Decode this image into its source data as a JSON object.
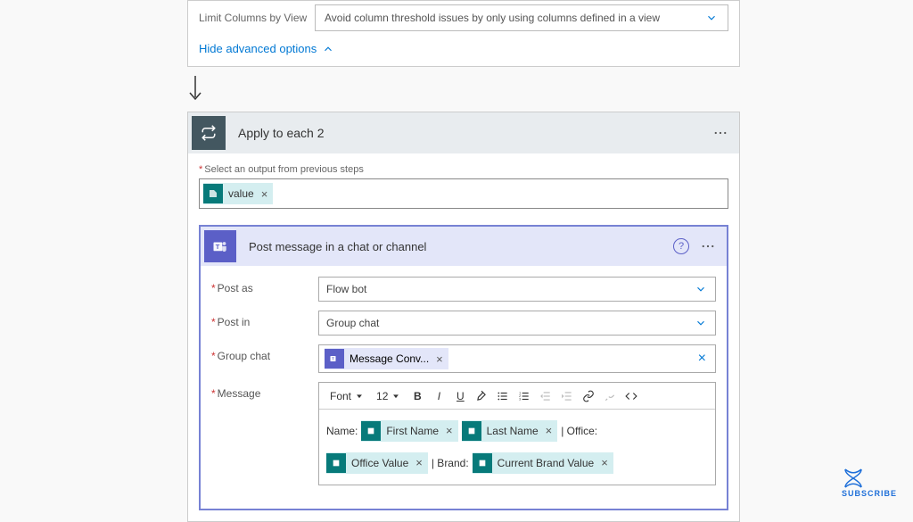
{
  "top": {
    "limit_label": "Limit Columns by View",
    "limit_value": "Avoid column threshold issues by only using columns defined in a view",
    "hide_advanced": "Hide advanced options"
  },
  "loop": {
    "title": "Apply to each 2",
    "select_output_label": "Select an output from previous steps",
    "value_token": "value"
  },
  "teams": {
    "title": "Post message in a chat or channel",
    "post_as_label": "Post as",
    "post_as_value": "Flow bot",
    "post_in_label": "Post in",
    "post_in_value": "Group chat",
    "group_chat_label": "Group chat",
    "group_chat_token": "Message Conv...",
    "message_label": "Message"
  },
  "toolbar": {
    "font_label": "Font",
    "size": "12"
  },
  "message": {
    "name_prefix": "Name:",
    "first_name_token": "First Name",
    "last_name_token": "Last Name",
    "office_prefix": "| Office:",
    "office_value_token": "Office Value",
    "brand_prefix": "| Brand:",
    "brand_value_token": "Current Brand Value"
  },
  "watermark": {
    "text": "SUBSCRIBE"
  }
}
